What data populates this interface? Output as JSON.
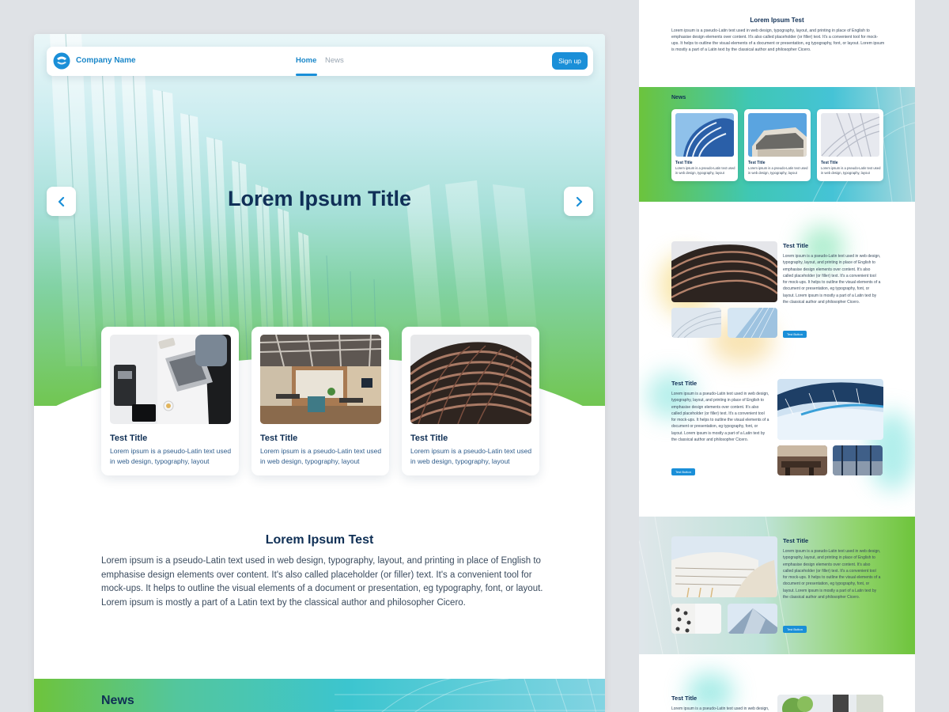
{
  "main": {
    "navbar": {
      "brand": "Company Name",
      "links": [
        "Home",
        "News"
      ],
      "signup_label": "Sign up"
    },
    "hero": {
      "title": "Lorem Ipsum Title",
      "prev_icon": "chevron-left-icon",
      "next_icon": "chevron-right-icon"
    },
    "cards": [
      {
        "title": "Test Title",
        "text": "Lorem ipsum is a pseudo-Latin text used in web design, typography, layout",
        "image": "laptop-desk-photo"
      },
      {
        "title": "Test Title",
        "text": "Lorem ipsum is a pseudo-Latin text used in web design, typography, layout",
        "image": "office-interior-photo"
      },
      {
        "title": "Test Title",
        "text": "Lorem ipsum is a pseudo-Latin text used in web design, typography, layout",
        "image": "building-facade-photo"
      }
    ],
    "section": {
      "title": "Lorem Ipsum Test",
      "body": "Lorem ipsum is a pseudo-Latin text used in web design, typography, layout, and printing in place of English to emphasise design elements over content. It's also called placeholder (or filler) text. It's a convenient tool for mock-ups. It helps to outline the visual elements of a document or presentation, eg typography, font, or layout. Lorem ipsum is mostly a part of a Latin text by the classical author and philosopher Cicero."
    },
    "news_heading": "News"
  },
  "side": {
    "section": {
      "title": "Lorem Ipsum Test",
      "body": "Lorem ipsum is a pseudo-Latin text used in web design, typography, layout, and printing in place of English to emphasise design elements over content. It's also called placeholder (or filler) text. It's a convenient tool for mock-ups. It helps to outline the visual elements of a document or presentation, eg typography, font, or layout. Lorem ipsum is mostly a part of a Latin text by the classical author and philosopher Cicero."
    },
    "news": {
      "label": "News",
      "cards": [
        {
          "title": "Test Title",
          "text": "Lorem ipsum is a pseudo-Latin text used in web design, typography, layout"
        },
        {
          "title": "Test Title",
          "text": "Lorem ipsum is a pseudo-Latin text used in web design, typography, layout"
        },
        {
          "title": "Test Title",
          "text": "Lorem ipsum is a pseudo-Latin text used in web design, typography, layout"
        }
      ]
    },
    "features": [
      {
        "title": "Test Title",
        "text": "Lorem ipsum is a pseudo-Latin text used in web design, typography, layout, and printing in place of English to emphasise design elements over content. It's also called placeholder (or filler) text. It's a convenient tool for mock-ups. It helps to outline the visual elements of a document or presentation, eg typography, font, or layout. Lorem ipsum is mostly a part of a Latin text by the classical author and philosopher Cicero.",
        "button": "Test Button"
      },
      {
        "title": "Test Title",
        "text": "Lorem ipsum is a pseudo-Latin text used in web design, typography, layout, and printing in place of English to emphasise design elements over content. It's also called placeholder (or filler) text. It's a convenient tool for mock-ups. It helps to outline the visual elements of a document or presentation, eg typography, font, or layout. Lorem ipsum is mostly a part of a Latin text by the classical author and philosopher Cicero.",
        "button": "Test Button"
      },
      {
        "title": "Test Title",
        "text": "Lorem ipsum is a pseudo-Latin text used in web design, typography, layout, and printing in place of English to emphasise design elements over content. It's also called placeholder (or filler) text. It's a convenient tool for mock-ups. It helps to outline the visual elements of a document or presentation, eg typography, font, or layout. Lorem ipsum is mostly a part of a Latin text by the classical author and philosopher Cicero.",
        "button": "Test Button"
      },
      {
        "title": "Test Title",
        "text": "Lorem ipsum is a pseudo-Latin text used in web design, typography,"
      }
    ]
  },
  "colors": {
    "primary": "#1a8fd8",
    "heading": "#0f2f55",
    "green": "#6ec43b",
    "cyan": "#3cc5cf",
    "background": "#dfe2e6"
  }
}
